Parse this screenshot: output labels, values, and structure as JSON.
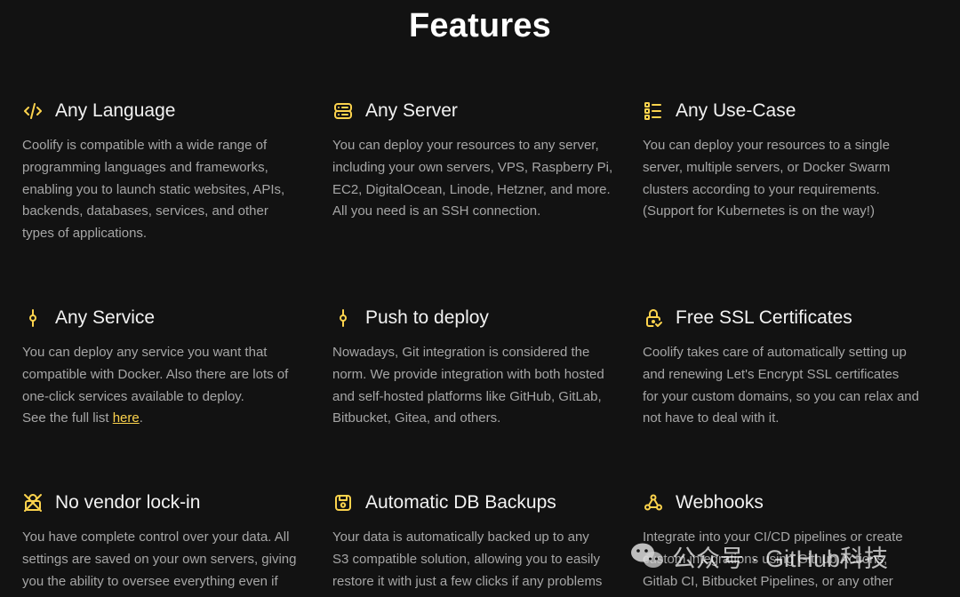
{
  "page": {
    "title": "Features",
    "accent": "#fcd34d"
  },
  "features": [
    {
      "title": "Any Language",
      "icon": "code-icon",
      "lines": [
        "Coolify is compatible with a wide range of",
        "programming languages and frameworks,",
        "enabling you to launch static websites, APIs,",
        "backends, databases, services, and other",
        "types of applications."
      ]
    },
    {
      "title": "Any Server",
      "icon": "server-icon",
      "lines": [
        "You can deploy your resources to any server,",
        "including your own servers, VPS, Raspberry Pi,",
        "EC2, DigitalOcean, Linode, Hetzner, and more.",
        "All you need is an SSH connection."
      ]
    },
    {
      "title": "Any Use-Case",
      "icon": "list-icon",
      "lines": [
        "You can deploy your resources to a single",
        "server, multiple servers, or Docker Swarm",
        "clusters according to your requirements.",
        "(Support for Kubernetes is on the way!)"
      ]
    },
    {
      "title": "Any Service",
      "icon": "git-commit-icon",
      "lines": [
        "You can deploy any service you want that",
        "compatible with Docker. Also there are lots of",
        "one-click services available to deploy."
      ],
      "link_prefix": "See the full list ",
      "link_text": "here",
      "link_suffix": "."
    },
    {
      "title": "Push to deploy",
      "icon": "git-commit-icon",
      "lines": [
        "Nowadays, Git integration is considered the",
        "norm. We provide integration with both hosted",
        "and self-hosted platforms like GitHub, GitLab,",
        "Bitbucket, Gitea, and others."
      ]
    },
    {
      "title": "Free SSL Certificates",
      "icon": "lock-check-icon",
      "lines": [
        "Coolify takes care of automatically setting up",
        "and renewing Let's Encrypt SSL certificates",
        "for your custom domains, so you can relax and",
        "not have to deal with it."
      ]
    },
    {
      "title": "No vendor lock-in",
      "icon": "no-lock-icon",
      "lines": [
        "You have complete control over your data. All",
        "settings are saved on your own servers, giving",
        "you the ability to oversee everything even if"
      ]
    },
    {
      "title": "Automatic DB Backups",
      "icon": "database-backup-icon",
      "lines": [
        "Your data is automatically backed up to any",
        "S3 compatible solution, allowing you to easily",
        "restore it with just a few clicks if any problems"
      ]
    },
    {
      "title": "Webhooks",
      "icon": "webhook-icon",
      "lines": [
        "Integrate into your CI/CD pipelines or create",
        "custom integrations using Github Actions,",
        "Gitlab CI, Bitbucket Pipelines, or any other"
      ]
    }
  ],
  "watermark": {
    "text": "公众号 · GitHub科技",
    "icon": "wechat-icon"
  }
}
